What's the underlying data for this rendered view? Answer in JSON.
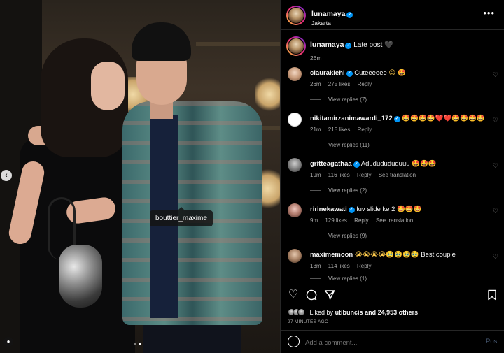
{
  "photo": {
    "tagged_user": "bouttier_maxime",
    "carousel_dots": 2,
    "carousel_active": 2
  },
  "post": {
    "username": "lunamaya",
    "location": "Jakarta"
  },
  "caption": {
    "username": "lunamaya",
    "text": "Late post",
    "emoji": "🖤",
    "time": "26m"
  },
  "comments": [
    {
      "username": "claurakiehl",
      "verified": true,
      "text": "Cuteeeeee",
      "emoji": "😉 🤩",
      "time": "26m",
      "likes": "275 likes",
      "reply": "Reply",
      "see_translation": "",
      "view_replies": "View replies (7)"
    },
    {
      "username": "nikitamirzanimawardi_172",
      "verified": true,
      "text": "",
      "emoji": "🤩🤩🤩🤩❤️❤️🤩🤩🤩🤩",
      "time": "21m",
      "likes": "215 likes",
      "reply": "Reply",
      "see_translation": "",
      "view_replies": "View replies (11)"
    },
    {
      "username": "gritteagathaa",
      "verified": true,
      "text": "Adududududuuu",
      "emoji": "🤩🤩🤩",
      "time": "19m",
      "likes": "116 likes",
      "reply": "Reply",
      "see_translation": "See translation",
      "view_replies": "View replies (2)"
    },
    {
      "username": "ririnekawati",
      "verified": true,
      "text": "luv slide ke 2",
      "emoji": "🤩🤩🤩",
      "time": "9m",
      "likes": "129 likes",
      "reply": "Reply",
      "see_translation": "See translation",
      "view_replies": "View replies (9)"
    },
    {
      "username": "maximemoon",
      "verified": false,
      "text": "Best couple",
      "emoji": "😭😭😭😭🥹🥹🥹🥹",
      "time": "13m",
      "likes": "114 likes",
      "reply": "Reply",
      "see_translation": "",
      "view_replies": "View replies (1)"
    }
  ],
  "engagement": {
    "liked_by_prefix": "Liked by",
    "liked_by_user": "utibuncis",
    "liked_by_suffix": "and 24,953 others",
    "timestamp": "27 MINUTES AGO"
  },
  "comment_box": {
    "placeholder": "Add a comment...",
    "post_label": "Post"
  },
  "icons": {
    "like": "heart-icon",
    "comment": "comment-icon",
    "share": "send-icon",
    "save": "bookmark-icon",
    "more": "more-options-icon",
    "emoji": "smiley-icon",
    "carousel_prev": "chevron-left-icon",
    "tagged_people": "person-icon"
  },
  "colors": {
    "background": "#000000",
    "verified": "#0095f6",
    "secondary_text": "#a8a8a8",
    "post_disabled": "#4a5d78"
  }
}
